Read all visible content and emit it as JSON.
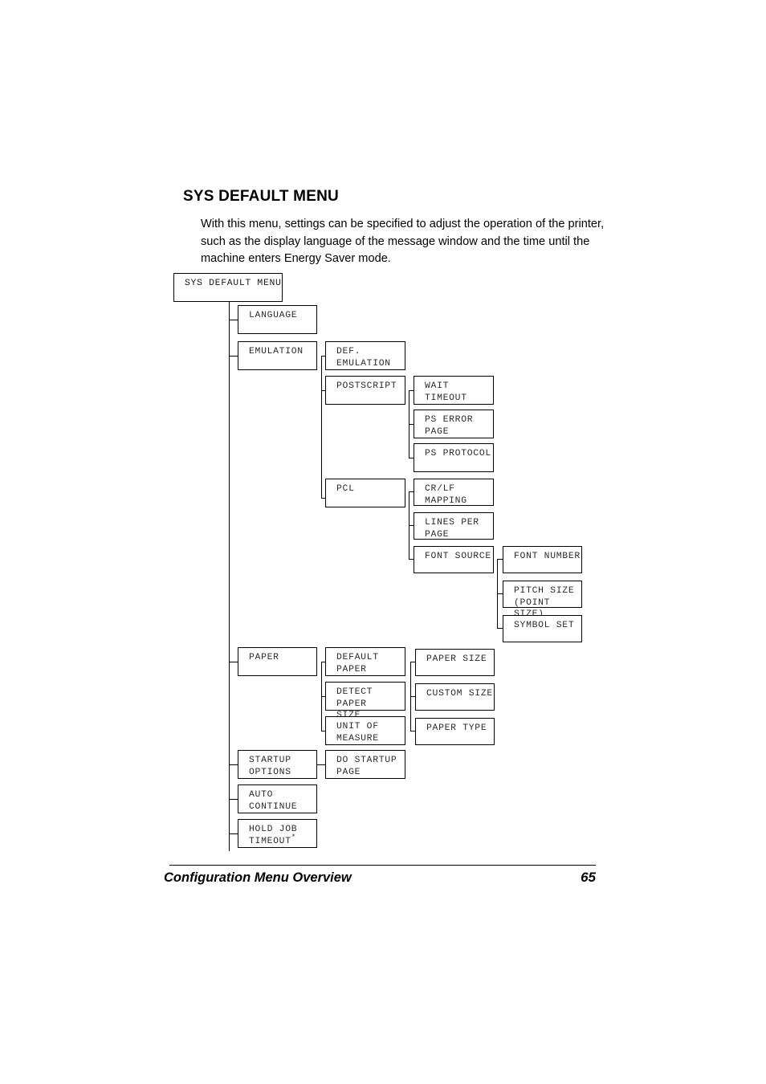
{
  "page": {
    "heading": "SYS DEFAULT MENU",
    "intro": "With this menu, settings can be specified to adjust the operation of the printer, such as the display language of the message window and the time until the machine enters Energy Saver mode.",
    "footer_title": "Configuration Menu Overview",
    "footer_page_number": "65"
  },
  "colors": {
    "line": "#000000",
    "box_text": "#2b2b2b",
    "background": "#ffffff"
  },
  "tree": {
    "root": {
      "label": "SYS DEFAULT MENU"
    },
    "level1": [
      {
        "label": "LANGUAGE"
      },
      {
        "label": "EMULATION"
      },
      {
        "label": "PAPER"
      },
      {
        "label": "STARTUP\nOPTIONS"
      },
      {
        "label": "AUTO\nCONTINUE"
      },
      {
        "label": "HOLD JOB\nTIMEOUT",
        "footnote": "*"
      }
    ],
    "emulation_children": [
      {
        "label": "DEF.\nEMULATION"
      },
      {
        "label": "POSTSCRIPT"
      },
      {
        "label": "PCL"
      }
    ],
    "postscript_children": [
      {
        "label": "WAIT\nTIMEOUT"
      },
      {
        "label": "PS ERROR\nPAGE"
      },
      {
        "label": "PS PROTOCOL"
      }
    ],
    "pcl_children": [
      {
        "label": "CR/LF\nMAPPING"
      },
      {
        "label": "LINES PER\nPAGE"
      },
      {
        "label": "FONT SOURCE"
      }
    ],
    "font_source_children": [
      {
        "label": "FONT NUMBER"
      },
      {
        "label": "PITCH SIZE\n(POINT SIZE)"
      },
      {
        "label": "SYMBOL SET"
      }
    ],
    "paper_children": [
      {
        "label": "DEFAULT\nPAPER"
      },
      {
        "label": "DETECT PAPER\nSIZE"
      },
      {
        "label": "UNIT OF\nMEASURE"
      }
    ],
    "default_paper_children": [
      {
        "label": "PAPER SIZE"
      },
      {
        "label": "CUSTOM SIZE"
      },
      {
        "label": "PAPER TYPE"
      }
    ],
    "startup_options_children": [
      {
        "label": "DO STARTUP\nPAGE"
      }
    ]
  }
}
